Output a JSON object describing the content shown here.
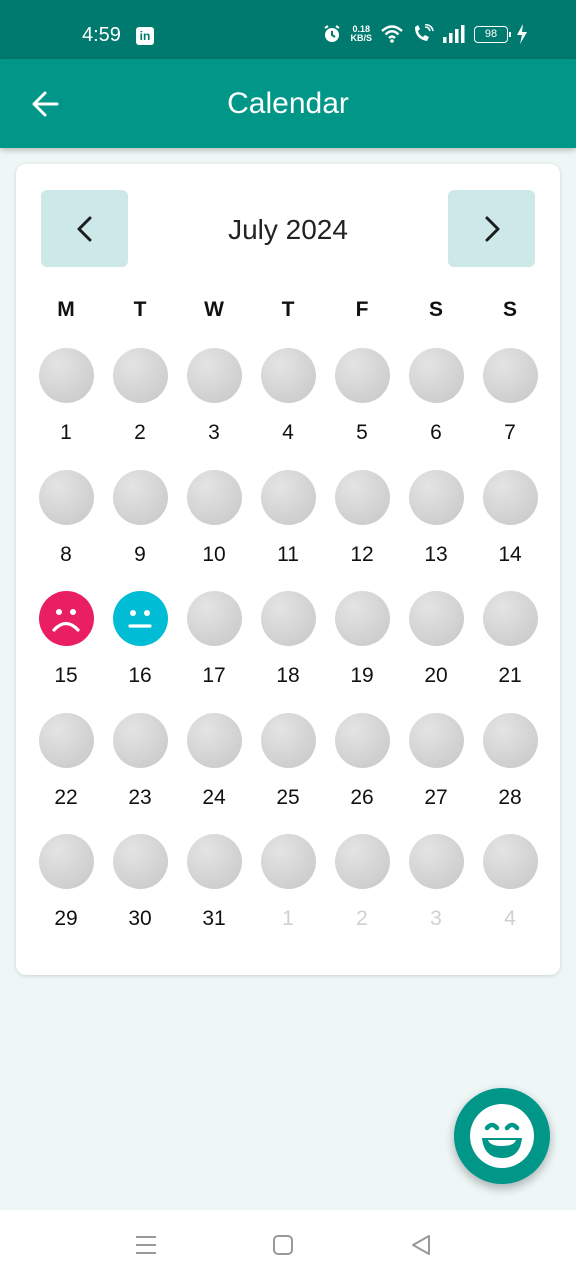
{
  "status_bar": {
    "time": "4:59",
    "net_speed_value": "0.18",
    "net_speed_unit": "KB/S",
    "battery": "98"
  },
  "app_bar": {
    "title": "Calendar"
  },
  "calendar": {
    "month_label": "July 2024",
    "weekdays": [
      "M",
      "T",
      "W",
      "T",
      "F",
      "S",
      "S"
    ],
    "days": [
      {
        "label": "1",
        "mood": "none",
        "current_month": true
      },
      {
        "label": "2",
        "mood": "none",
        "current_month": true
      },
      {
        "label": "3",
        "mood": "none",
        "current_month": true
      },
      {
        "label": "4",
        "mood": "none",
        "current_month": true
      },
      {
        "label": "5",
        "mood": "none",
        "current_month": true
      },
      {
        "label": "6",
        "mood": "none",
        "current_month": true
      },
      {
        "label": "7",
        "mood": "none",
        "current_month": true
      },
      {
        "label": "8",
        "mood": "none",
        "current_month": true
      },
      {
        "label": "9",
        "mood": "none",
        "current_month": true
      },
      {
        "label": "10",
        "mood": "none",
        "current_month": true
      },
      {
        "label": "11",
        "mood": "none",
        "current_month": true
      },
      {
        "label": "12",
        "mood": "none",
        "current_month": true
      },
      {
        "label": "13",
        "mood": "none",
        "current_month": true
      },
      {
        "label": "14",
        "mood": "none",
        "current_month": true
      },
      {
        "label": "15",
        "mood": "sad",
        "current_month": true
      },
      {
        "label": "16",
        "mood": "neutral",
        "current_month": true
      },
      {
        "label": "17",
        "mood": "none",
        "current_month": true
      },
      {
        "label": "18",
        "mood": "none",
        "current_month": true
      },
      {
        "label": "19",
        "mood": "none",
        "current_month": true
      },
      {
        "label": "20",
        "mood": "none",
        "current_month": true
      },
      {
        "label": "21",
        "mood": "none",
        "current_month": true
      },
      {
        "label": "22",
        "mood": "none",
        "current_month": true
      },
      {
        "label": "23",
        "mood": "none",
        "current_month": true
      },
      {
        "label": "24",
        "mood": "none",
        "current_month": true
      },
      {
        "label": "25",
        "mood": "none",
        "current_month": true
      },
      {
        "label": "26",
        "mood": "none",
        "current_month": true
      },
      {
        "label": "27",
        "mood": "none",
        "current_month": true
      },
      {
        "label": "28",
        "mood": "none",
        "current_month": true
      },
      {
        "label": "29",
        "mood": "none",
        "current_month": true
      },
      {
        "label": "30",
        "mood": "none",
        "current_month": true
      },
      {
        "label": "31",
        "mood": "none",
        "current_month": true
      },
      {
        "label": "1",
        "mood": "none",
        "current_month": false
      },
      {
        "label": "2",
        "mood": "none",
        "current_month": false
      },
      {
        "label": "3",
        "mood": "none",
        "current_month": false
      },
      {
        "label": "4",
        "mood": "none",
        "current_month": false
      }
    ]
  },
  "colors": {
    "primary": "#009688",
    "status_bar": "#007a6e",
    "sad": "#e91e63",
    "neutral": "#00bcd4",
    "nav_button_bg": "#cce8e8"
  },
  "icons": {
    "back": "arrow-left-icon",
    "prev": "chevron-left-icon",
    "next": "chevron-right-icon",
    "fab": "laughing-face-icon"
  }
}
